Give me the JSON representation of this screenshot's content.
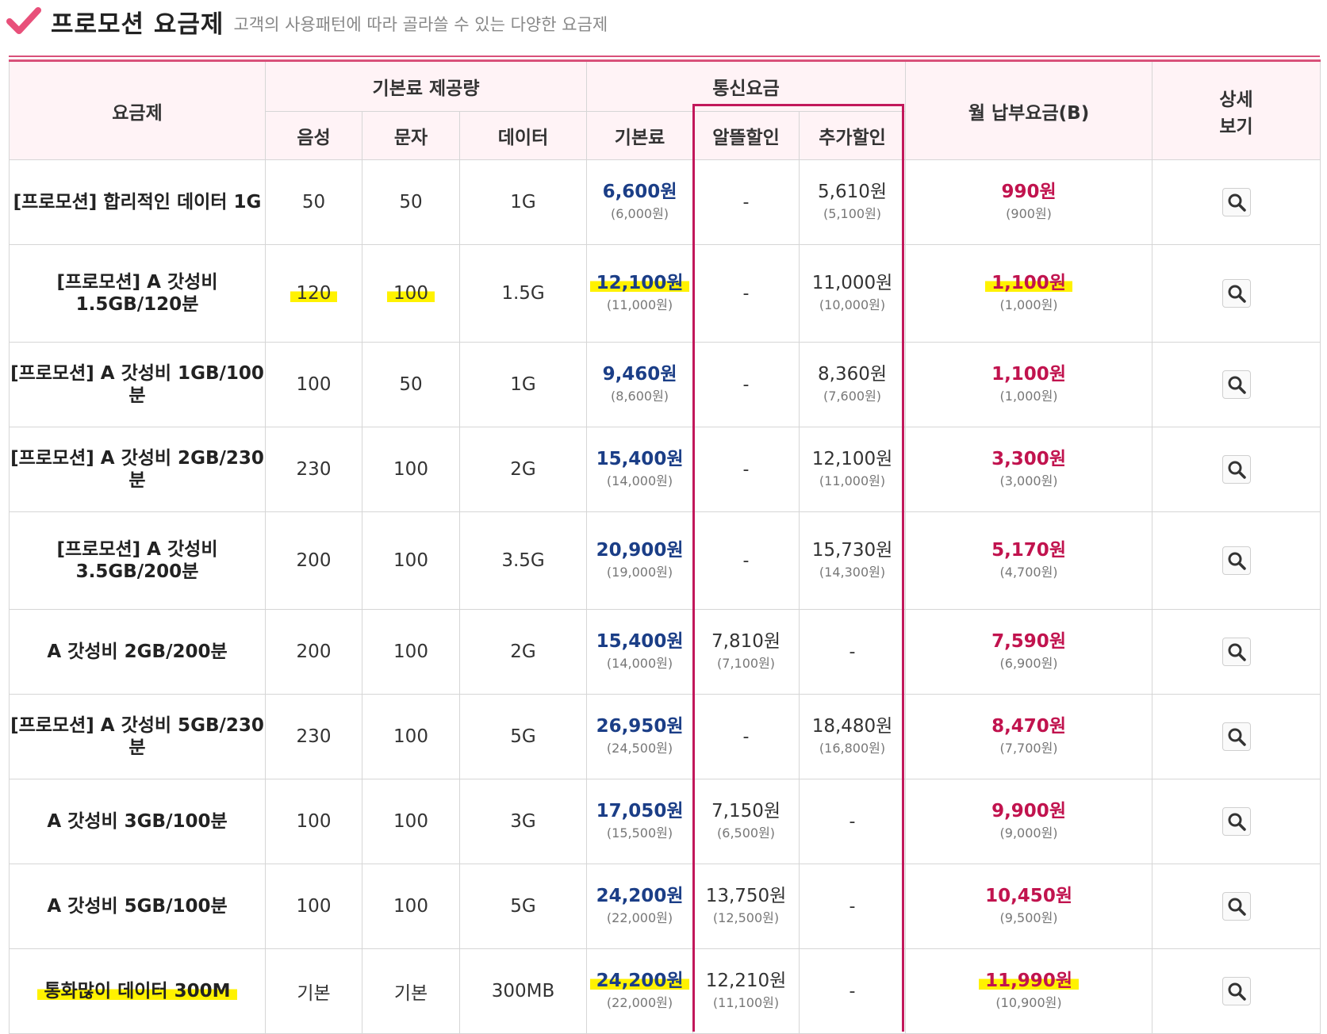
{
  "header": {
    "title": "프로모션 요금제",
    "subtitle": "고객의 사용패턴에 따라 골라쓸 수 있는 다양한 요금제",
    "icon": "check-icon",
    "accent_color": "#e8507a"
  },
  "table": {
    "col_plan": "요금제",
    "group_allowance": "기본료 제공량",
    "group_fees": "통신요금",
    "col_monthly": "월 납부요금(B)",
    "col_detail_line1": "상세",
    "col_detail_line2": "보기",
    "col_voice": "음성",
    "col_text": "문자",
    "col_data": "데이터",
    "col_base": "기본료",
    "col_discount": "알뜰할인",
    "col_extra": "추가할인",
    "detail_icon": "magnifier-icon",
    "rows": [
      {
        "name": "[프로모션] 합리적인 데이터 1G",
        "voice": "50",
        "text": "50",
        "data": "1G",
        "base": "6,600원",
        "base_sub": "(6,000원)",
        "disc": "-",
        "disc_sub": "",
        "extra": "5,610원",
        "extra_sub": "(5,100원)",
        "monthly": "990원",
        "monthly_sub": "(900원)"
      },
      {
        "name": "[프로모션] A 갓성비 1.5GB/120분",
        "voice": "120",
        "text": "100",
        "data": "1.5G",
        "base": "12,100원",
        "base_sub": "(11,000원)",
        "disc": "-",
        "disc_sub": "",
        "extra": "11,000원",
        "extra_sub": "(10,000원)",
        "monthly": "1,100원",
        "monthly_sub": "(1,000원)"
      },
      {
        "name": "[프로모션] A 갓성비 1GB/100분",
        "voice": "100",
        "text": "50",
        "data": "1G",
        "base": "9,460원",
        "base_sub": "(8,600원)",
        "disc": "-",
        "disc_sub": "",
        "extra": "8,360원",
        "extra_sub": "(7,600원)",
        "monthly": "1,100원",
        "monthly_sub": "(1,000원)"
      },
      {
        "name": "[프로모션] A 갓성비 2GB/230분",
        "voice": "230",
        "text": "100",
        "data": "2G",
        "base": "15,400원",
        "base_sub": "(14,000원)",
        "disc": "-",
        "disc_sub": "",
        "extra": "12,100원",
        "extra_sub": "(11,000원)",
        "monthly": "3,300원",
        "monthly_sub": "(3,000원)"
      },
      {
        "name": "[프로모션] A 갓성비 3.5GB/200분",
        "voice": "200",
        "text": "100",
        "data": "3.5G",
        "base": "20,900원",
        "base_sub": "(19,000원)",
        "disc": "-",
        "disc_sub": "",
        "extra": "15,730원",
        "extra_sub": "(14,300원)",
        "monthly": "5,170원",
        "monthly_sub": "(4,700원)"
      },
      {
        "name": "A 갓성비 2GB/200분",
        "voice": "200",
        "text": "100",
        "data": "2G",
        "base": "15,400원",
        "base_sub": "(14,000원)",
        "disc": "7,810원",
        "disc_sub": "(7,100원)",
        "extra": "-",
        "extra_sub": "",
        "monthly": "7,590원",
        "monthly_sub": "(6,900원)"
      },
      {
        "name": "[프로모션] A 갓성비 5GB/230분",
        "voice": "230",
        "text": "100",
        "data": "5G",
        "base": "26,950원",
        "base_sub": "(24,500원)",
        "disc": "-",
        "disc_sub": "",
        "extra": "18,480원",
        "extra_sub": "(16,800원)",
        "monthly": "8,470원",
        "monthly_sub": "(7,700원)"
      },
      {
        "name": "A 갓성비 3GB/100분",
        "voice": "100",
        "text": "100",
        "data": "3G",
        "base": "17,050원",
        "base_sub": "(15,500원)",
        "disc": "7,150원",
        "disc_sub": "(6,500원)",
        "extra": "-",
        "extra_sub": "",
        "monthly": "9,900원",
        "monthly_sub": "(9,000원)"
      },
      {
        "name": "A 갓성비 5GB/100분",
        "voice": "100",
        "text": "100",
        "data": "5G",
        "base": "24,200원",
        "base_sub": "(22,000원)",
        "disc": "13,750원",
        "disc_sub": "(12,500원)",
        "extra": "-",
        "extra_sub": "",
        "monthly": "10,450원",
        "monthly_sub": "(9,500원)"
      },
      {
        "name": "통화많이 데이터 300M",
        "voice": "기본",
        "text": "기본",
        "data": "300MB",
        "base": "24,200원",
        "base_sub": "(22,000원)",
        "disc": "12,210원",
        "disc_sub": "(11,100원)",
        "extra": "-",
        "extra_sub": "",
        "monthly": "11,990원",
        "monthly_sub": "(10,900원)"
      }
    ]
  },
  "colors": {
    "base_price": "#1b3e87",
    "monthly_price": "#c1134e",
    "header_bg": "#fff3f6",
    "highlight": "#fff200",
    "box_border": "#c2185b"
  }
}
